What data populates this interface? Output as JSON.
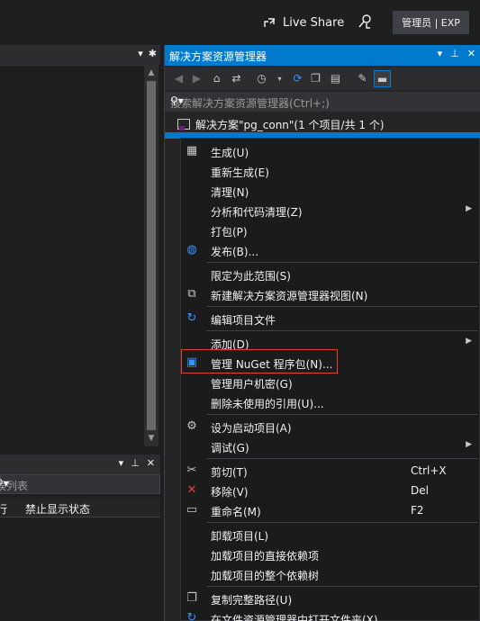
{
  "titlebar": {
    "live_share": "Live Share",
    "user_badge": "管理员 | EXP"
  },
  "error_list": {
    "search_placeholder": "误列表",
    "col_line": "行",
    "col_suppress": "禁止显示状态"
  },
  "solution_explorer": {
    "title": "解决方案资源管理器",
    "search_placeholder": "搜索解决方案资源管理器(Ctrl+;)",
    "solution_label": "解决方案\"pg_conn\"(1 个项目/共 1 个)"
  },
  "context_menu": {
    "items": [
      {
        "label": "生成(U)",
        "icon": "build-icon"
      },
      {
        "label": "重新生成(E)"
      },
      {
        "label": "清理(N)"
      },
      {
        "label": "分析和代码清理(Z)",
        "submenu": true
      },
      {
        "label": "打包(P)"
      },
      {
        "label": "发布(B)...",
        "icon": "globe-icon"
      },
      {
        "label": "限定为此范围(S)"
      },
      {
        "label": "新建解决方案资源管理器视图(N)",
        "icon": "new-view-icon"
      },
      {
        "label": "编辑项目文件",
        "icon": "refresh-icon"
      },
      {
        "label": "添加(D)",
        "submenu": true
      },
      {
        "label": "管理 NuGet 程序包(N)...",
        "icon": "nuget-icon"
      },
      {
        "label": "管理用户机密(G)"
      },
      {
        "label": "删除未使用的引用(U)..."
      },
      {
        "label": "设为启动项目(A)",
        "icon": "gear-icon"
      },
      {
        "label": "调试(G)",
        "submenu": true
      },
      {
        "label": "剪切(T)",
        "shortcut": "Ctrl+X",
        "icon": "scissors-icon"
      },
      {
        "label": "移除(V)",
        "shortcut": "Del",
        "icon": "remove-icon"
      },
      {
        "label": "重命名(M)",
        "shortcut": "F2",
        "icon": "rename-icon"
      },
      {
        "label": "卸载项目(L)"
      },
      {
        "label": "加载项目的直接依赖项"
      },
      {
        "label": "加载项目的整个依赖树"
      },
      {
        "label": "复制完整路径(U)",
        "icon": "copy-icon"
      },
      {
        "label": "在文件资源管理器中打开文件夹(X)",
        "icon": "folder-refresh-icon"
      }
    ]
  },
  "colors": {
    "accent": "#007acc",
    "highlight_border": "#e0443e",
    "menu_bg": "#1b1b1c"
  }
}
